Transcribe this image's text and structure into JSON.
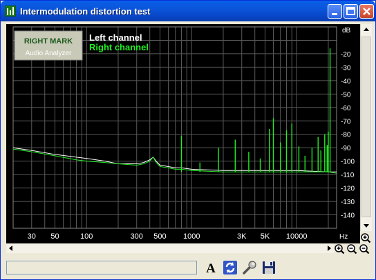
{
  "window": {
    "title": "Intermodulation distortion test"
  },
  "logo": {
    "line1": "RIGHT MARK",
    "line2": "Audio Analyzer"
  },
  "legend": [
    {
      "label": "Left channel",
      "color": "#ffffff"
    },
    {
      "label": "Right channel",
      "color": "#22ee22"
    }
  ],
  "chart_data": {
    "type": "line",
    "x_scale": "log",
    "xlabel": "Hz",
    "ylabel": "dB",
    "xlim": [
      20,
      24000
    ],
    "ylim": [
      -150,
      0
    ],
    "x_ticks": [
      30,
      50,
      100,
      300,
      500,
      1000,
      3000,
      5000,
      10000
    ],
    "x_tick_labels": [
      "30",
      "50",
      "100",
      "300",
      "500",
      "1000",
      "3K",
      "5K",
      "10000"
    ],
    "y_ticks": [
      -20,
      -30,
      -40,
      -50,
      -60,
      -70,
      -80,
      -90,
      -100,
      -110,
      -120,
      -130,
      -140
    ],
    "y_tick_labels": [
      "-20",
      "-30",
      "-40",
      "-50",
      "-60",
      "-70",
      "-80",
      "-90",
      "-100",
      "-110",
      "-120",
      "-130",
      "-140"
    ],
    "grid": true,
    "series": [
      {
        "name": "Left channel",
        "color": "#ffffff",
        "x": [
          20,
          30,
          50,
          80,
          100,
          150,
          200,
          300,
          350,
          400,
          430,
          460,
          500,
          600,
          700,
          800,
          1000,
          2000,
          5000,
          10000,
          20000,
          24000
        ],
        "y": [
          -90,
          -92,
          -95,
          -97,
          -98,
          -100,
          -102,
          -102,
          -101,
          -99,
          -97,
          -100,
          -103,
          -104,
          -105,
          -105,
          -106,
          -107,
          -107,
          -107,
          -108,
          -108
        ]
      },
      {
        "name": "Right channel",
        "color": "#22ee22",
        "x": [
          20,
          30,
          50,
          80,
          100,
          150,
          200,
          300,
          350,
          400,
          430,
          460,
          500,
          600,
          700,
          800,
          1000,
          2000,
          5000,
          10000,
          20000,
          24000
        ],
        "y": [
          -91,
          -93,
          -96,
          -99,
          -100,
          -101,
          -102,
          -103,
          -102,
          -100,
          -97,
          -101,
          -104,
          -105,
          -106,
          -106,
          -107,
          -108,
          -108,
          -108,
          -108,
          -109
        ]
      },
      {
        "name": "Right channel spikes",
        "color": "#22ee22",
        "x": [
          800,
          1200,
          1800,
          2600,
          3500,
          4500,
          5500,
          6000,
          7000,
          8000,
          9000,
          10500,
          12000,
          14000,
          16000,
          17000,
          18500,
          19500,
          20000,
          20800
        ],
        "y": [
          -81,
          -101,
          -90,
          -84,
          -93,
          -98,
          -76,
          -68,
          -86,
          -77,
          -72,
          -89,
          -96,
          -90,
          -82,
          -92,
          -80,
          -88,
          -78,
          -16
        ]
      }
    ]
  },
  "status": {
    "text": ""
  },
  "toolbar": {
    "font_tooltip": "A"
  }
}
